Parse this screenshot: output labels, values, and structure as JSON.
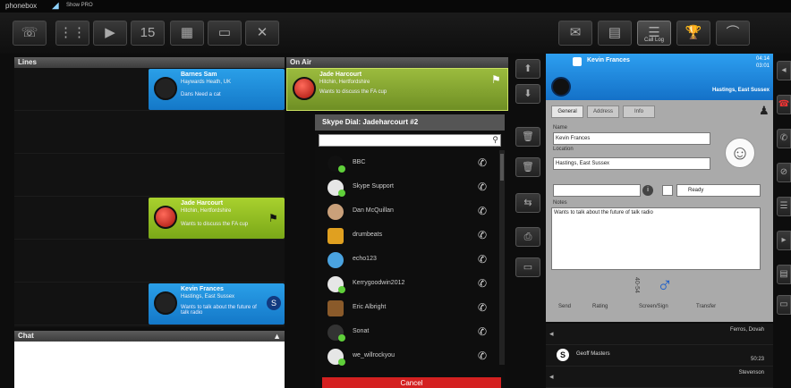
{
  "app": {
    "brand": "phonebox",
    "edition": "Show PRO"
  },
  "toolbar_left": [
    {
      "name": "phone-icon",
      "glyph": "☏"
    },
    {
      "name": "dialpad-icon",
      "glyph": "⋮⋮"
    },
    {
      "name": "play-icon",
      "glyph": "▶"
    },
    {
      "name": "counter-icon",
      "glyph": "15"
    },
    {
      "name": "grid-icon",
      "glyph": "▦"
    },
    {
      "name": "monitor-icon",
      "glyph": "▭"
    },
    {
      "name": "close-icon",
      "glyph": "✕"
    }
  ],
  "toolbar_right": [
    {
      "name": "mail-icon",
      "glyph": "✉"
    },
    {
      "name": "document-icon",
      "glyph": "▤"
    },
    {
      "name": "call-log-icon",
      "glyph": "☰",
      "label": "Call Log",
      "active": true
    },
    {
      "name": "trophy-icon",
      "glyph": "🏆"
    },
    {
      "name": "chart-icon",
      "glyph": "⌒"
    }
  ],
  "lines": {
    "title": "Lines",
    "callers": [
      {
        "name": "Barnes Sam",
        "location": "Haywards Heath, UK",
        "topic": "Dans Need a cat",
        "color": "blue"
      },
      {
        "name": "Jade Harcourt",
        "location": "Hitchin, Hertfordshire",
        "topic": "Wants to discuss the FA cup",
        "color": "green"
      },
      {
        "name": "Kevin Frances",
        "location": "Hastings, East Sussex",
        "topic": "Wants to talk about the future of talk radio",
        "color": "blue"
      }
    ]
  },
  "chat": {
    "title": "Chat"
  },
  "onair": {
    "title": "On Air",
    "caller": {
      "name": "Jade Harcourt",
      "location": "Hitchin, Hertfordshire",
      "topic": "Wants to discuss the FA cup"
    }
  },
  "skype_dial": {
    "title": "Skype Dial: Jadeharcourt #2",
    "search_value": "",
    "contacts": [
      {
        "name": "BBC"
      },
      {
        "name": "Skype Support"
      },
      {
        "name": "Dan McQuillan"
      },
      {
        "name": "drumbeats"
      },
      {
        "name": "echo123"
      },
      {
        "name": "Kerrygoodwin2012"
      },
      {
        "name": "Eric Albright"
      },
      {
        "name": "Sonat"
      },
      {
        "name": "we_willrockyou"
      }
    ],
    "cancel_label": "Cancel"
  },
  "caller_panel": {
    "header_name": "Kevin Frances",
    "time1": "04:14",
    "time2": "03:01",
    "place": "Hastings, East Sussex",
    "tabs": [
      "General",
      "Address",
      "Info"
    ],
    "name_label": "Name",
    "name_value": "Kevin Frances",
    "location_label": "Location",
    "location_value": "Hastings, East Sussex",
    "phone_value": "",
    "status_value": "Ready",
    "notes_label": "Notes",
    "notes_value": "Wants to talk about the future of talk radio",
    "age_value": "40-54",
    "actions": [
      "Send",
      "Rating",
      "Screen/Sign",
      "Transfer"
    ]
  },
  "queue": [
    {
      "name": "",
      "r1": "Ferros, Dovah",
      "r2": ""
    },
    {
      "name": "Geoff Masters",
      "r1": "",
      "r2": "50:23"
    },
    {
      "name": "",
      "r1": "Stevenson",
      "r2": ""
    }
  ]
}
